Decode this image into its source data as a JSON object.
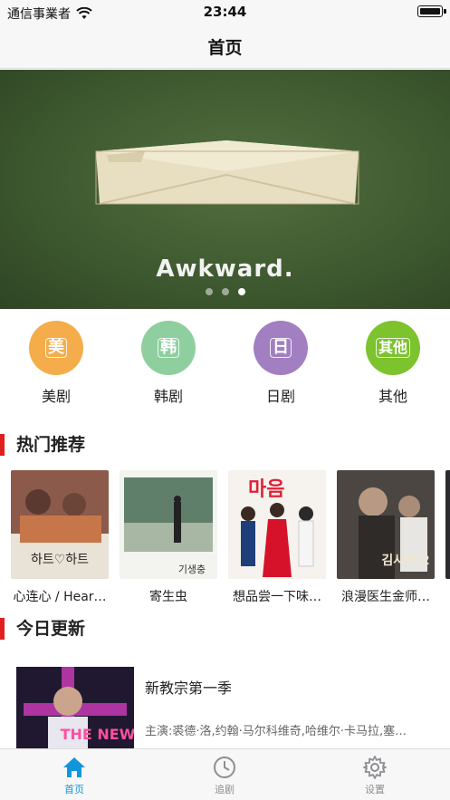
{
  "status_bar": {
    "carrier": "通信事業者",
    "time": "23:44"
  },
  "nav": {
    "title": "首页"
  },
  "banner": {
    "caption": "Awkward.",
    "page_count": 3,
    "active_page": 3
  },
  "categories": [
    {
      "label": "美剧",
      "icon_text": "美",
      "color": "#f4ad4a"
    },
    {
      "label": "韩剧",
      "icon_text": "韩",
      "color": "#8fcf9f"
    },
    {
      "label": "日剧",
      "icon_text": "日",
      "color": "#a17fc0"
    },
    {
      "label": "其他",
      "icon_text": "其他",
      "color": "#7cc32e"
    }
  ],
  "hot": {
    "title": "热门推荐",
    "items": [
      {
        "title": "心连心 / Hear…",
        "poster_text": "하트♡하트"
      },
      {
        "title": "寄生虫",
        "poster_text": "기생충"
      },
      {
        "title": "想品尝一下味…",
        "poster_text": "마음"
      },
      {
        "title": "浪漫医生金师…",
        "poster_text": "김사부 2"
      }
    ]
  },
  "today": {
    "title": "今日更新",
    "items": [
      {
        "title": "新教宗第一季",
        "cast": "主演:裘德·洛,约翰·马尔科维奇,哈维尔·卡马拉,塞…",
        "poster_text": "THE NEW"
      }
    ]
  },
  "tabs": [
    {
      "label": "首页",
      "icon": "home-icon",
      "active": true,
      "color": "#1296db"
    },
    {
      "label": "追剧",
      "icon": "clock-icon",
      "active": false
    },
    {
      "label": "设置",
      "icon": "gear-icon",
      "active": false
    }
  ]
}
